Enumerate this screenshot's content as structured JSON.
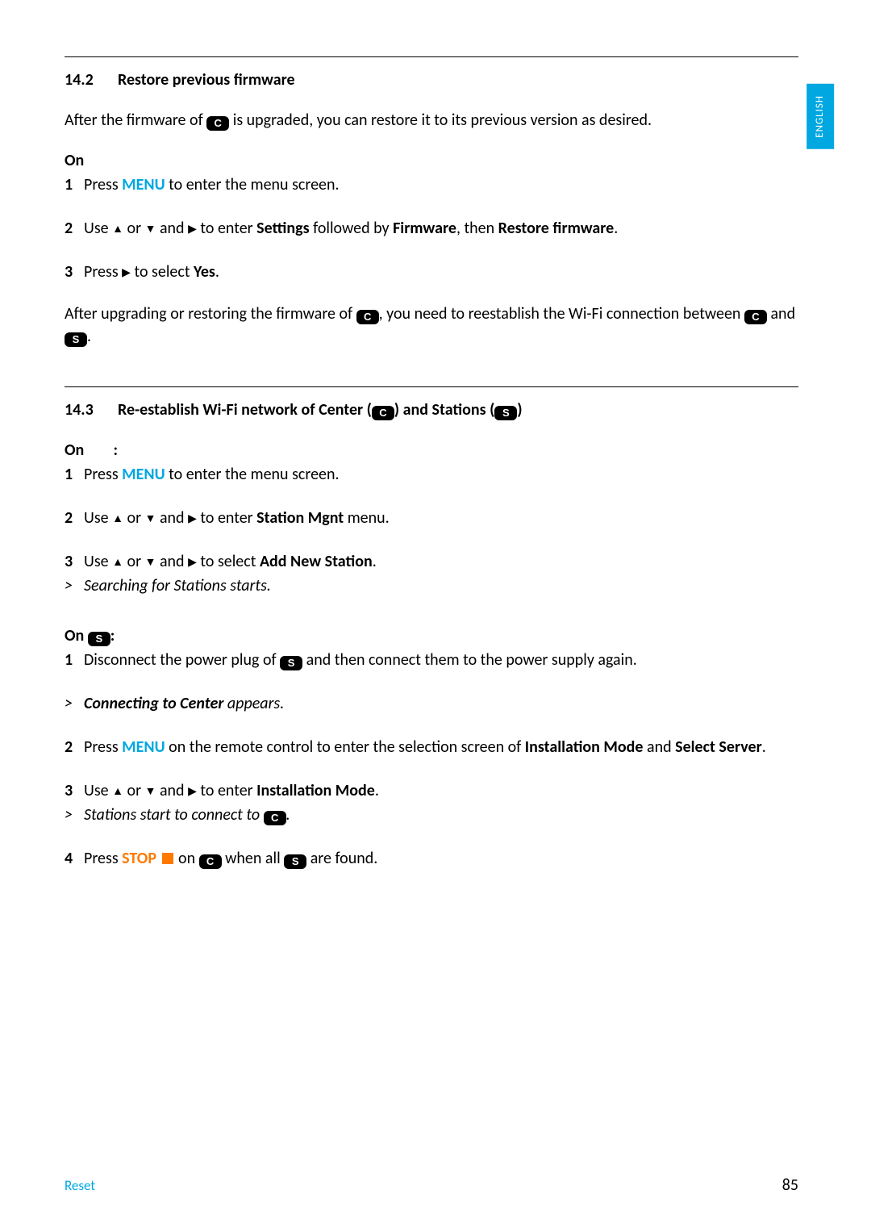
{
  "language_tab": "ENGLISH",
  "section142": {
    "number": "14.2",
    "title": "Restore previous firmware",
    "intro_before": "After the firmware of ",
    "intro_after": " is upgraded, you can restore it to its previous version as desired.",
    "on_label": "On",
    "step1_a": "Press ",
    "menu_key": "MENU",
    "step1_b": " to enter the menu screen.",
    "step2_a": "Use ",
    "step2_or": " or ",
    "step2_and": " and ",
    "step2_b": " to enter ",
    "settings": "Settings",
    "step2_c": " followed by ",
    "firmware": "Firmware",
    "step2_d": ", then ",
    "restore_fw": "Restore firmware",
    "step2_e": ".",
    "step3_a": "Press ",
    "step3_b": " to select ",
    "yes": "Yes",
    "step3_c": ".",
    "after_a": "After upgrading or restoring the firmware of ",
    "after_b": ", you need to reestablish the Wi-Fi connection between ",
    "after_c": " and ",
    "after_d": "."
  },
  "section143": {
    "number": "14.3",
    "title_a": "Re-establish Wi-Fi network of Center (",
    "title_b": ") and Stations (",
    "title_c": ")",
    "on_c_label_a": "On",
    "on_c_label_b": ":",
    "c_step1_a": "Press ",
    "c_step1_b": " to enter the menu screen.",
    "c_step2_a": "Use ",
    "c_step2_or": " or ",
    "c_step2_and": " and ",
    "c_step2_b": " to enter ",
    "station_mgnt": "Station Mgnt",
    "c_step2_c": " menu.",
    "c_step3_a": "Use ",
    "c_step3_b": " to select ",
    "add_new_station": "Add New Station",
    "c_step3_c": ".",
    "c_result1": "Searching for Stations starts.",
    "on_s_label_a": "On ",
    "on_s_label_b": ":",
    "s_step1_a": "Disconnect the power plug of ",
    "s_step1_b": " and then connect them to the power supply again.",
    "s_result1_a": "Connecting to Center",
    "s_result1_b": " appears.",
    "s_step2_a": "Press ",
    "s_step2_b": " on the remote control to enter the selection screen of ",
    "install_mode": "Installation Mode",
    "s_step2_c": " and ",
    "select_server": "Select Server",
    "s_step2_d": ".",
    "s_step3_a": "Use ",
    "s_step3_b": " to enter ",
    "s_step3_c": ".",
    "s_result2_a": "Stations start to connect to ",
    "s_result2_b": ".",
    "s_step4_a": "Press ",
    "stop_key": "STOP",
    "s_step4_b": " on ",
    "s_step4_c": " when all ",
    "s_step4_d": " are found."
  },
  "footer": {
    "left": "Reset",
    "right": "85"
  },
  "icons": {
    "C": "C",
    "S": "S"
  }
}
